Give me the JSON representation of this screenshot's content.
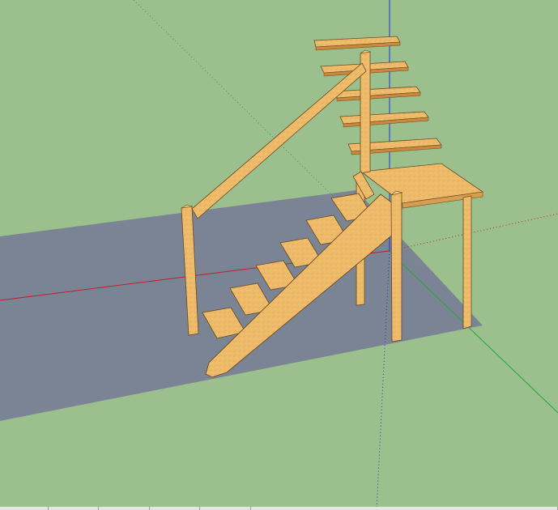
{
  "app": {
    "title": ""
  },
  "scene": {
    "background_color": "#9cc08d",
    "ground_shadow_color": "#7b8495",
    "wood_color": "#eebb6a",
    "wood_dark_color": "#c8893e",
    "wood_edge_color": "#6a4a20",
    "axis_colors": {
      "red": "#c0202a",
      "green": "#1fa83a",
      "blue": "#2233cc"
    },
    "objects": [
      "staircase",
      "handrail",
      "landing-table",
      "floating-steps"
    ]
  },
  "status_bar": {
    "cells": [
      "",
      "",
      "",
      "",
      "",
      ""
    ]
  }
}
